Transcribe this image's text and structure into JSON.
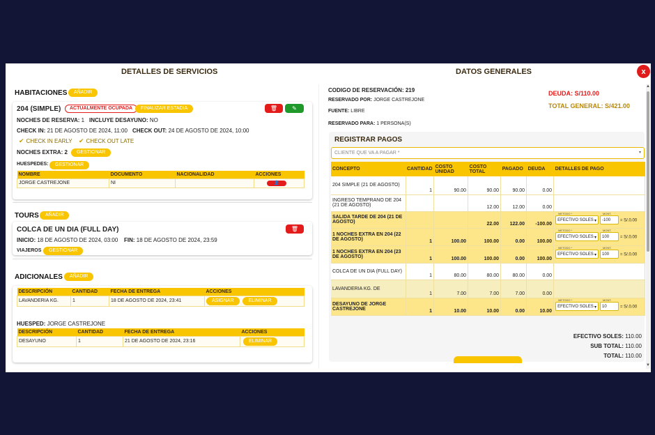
{
  "modal": {
    "left_title": "DETALLES DE SERVICIOS",
    "right_title": "DATOS GENERALES",
    "close_label": "x"
  },
  "habitaciones": {
    "title": "HABITACIONES",
    "add_label": "AÑADIR",
    "room": {
      "name": "204 (SIMPLE)",
      "status": "ACTUALMENTE OCUPADA",
      "finalize_label": "FINALIZAR ESTADIA",
      "noches_label": "NOCHES DE RESERVA:",
      "noches_value": "1",
      "desayuno_label": "INCLUYE DESAYUNO:",
      "desayuno_value": "NO",
      "checkin_label": "CHECK IN:",
      "checkin_value": "21 DE AGOSTO DE 2024, 11:00",
      "checkout_label": "CHECK OUT:",
      "checkout_value": "24 DE AGOSTO DE 2024, 10:00",
      "early_label": "CHECK IN EARLY",
      "late_label": "CHECK OUT LATE",
      "extra_label": "NOCHES EXTRA: 2",
      "extra_btn": "GESTIONAR",
      "huespedes_label": "HUESPEDES:",
      "huespedes_btn": "GESTIONAR",
      "table_headers": [
        "NOMBRE",
        "DOCUMENTO",
        "NACIONALIDAD",
        "ACCIONES"
      ],
      "guest": {
        "nombre": "JORGE CASTREJONE",
        "documento": "NI",
        "nacionalidad": ""
      }
    }
  },
  "tours": {
    "title": "TOURS",
    "add_label": "AÑADIR",
    "tour": {
      "name": "COLCA DE UN DIA (FULL DAY)",
      "inicio_label": "INICIO:",
      "inicio_value": "18 DE AGOSTO DE 2024, 03:00",
      "fin_label": "FIN:",
      "fin_value": "18 DE AGOSTO DE 2024, 23:59",
      "viajeros_label": "VIAJEROS",
      "viajeros_btn": "GESTIONAR"
    }
  },
  "adicionales": {
    "title": "ADICIONALES",
    "add_label": "AÑADIR",
    "headers": [
      "DESCRIPCIÓN",
      "CANTIDAD",
      "FECHA DE ENTREGA",
      "ACCIONES"
    ],
    "row": {
      "desc": "LAVANDERIA KG.",
      "cant": "1",
      "fecha": "18 DE AGOSTO DE 2024, 23:41",
      "asignar": "ASIGNAR",
      "eliminar": "ELIMINAR"
    },
    "huesped_label": "HUESPED:",
    "huesped_value": "JORGE CASTREJONE",
    "headers2": [
      "DESCRIPCIÓN",
      "CANTIDAD",
      "FECHA DE ENTREGA",
      "ACCIONES"
    ],
    "row2": {
      "desc": "DESAYUNO",
      "cant": "1",
      "fecha": "21 DE AGOSTO DE 2024, 23:16",
      "eliminar": "ELIMINAR"
    }
  },
  "general": {
    "codigo_label": "CODIGO DE RESERVACIÓN:",
    "codigo_value": "219",
    "reservado_por_label": "RESERVADO POR:",
    "reservado_por_value": "JORGE CASTREJONE",
    "fuente_label": "FUENTE:",
    "fuente_value": "LIBRE",
    "reservado_para_label": "RESERVADO PARA:",
    "reservado_para_value": "1 PERSONA(S)",
    "deuda_label": "DEUDA:",
    "deuda_value": "S/110.00",
    "total_label": "TOTAL GENERAL:",
    "total_value": "S/421.00"
  },
  "pagos": {
    "title": "REGISTRAR PAGOS",
    "select_placeholder": "CLIENTE QUE VA A PAGAR *",
    "headers": [
      "CONCEPTO",
      "CANTIDAD",
      "COSTO UNIDAD",
      "COSTO TOTAL",
      "PAGADO",
      "DEUDA",
      "DETALLES DE PAGO"
    ],
    "rows": [
      {
        "concepto": "204 SIMPLE (21 DE AGOSTO)",
        "cantidad": "1",
        "costo_unidad": "90.00",
        "costo_total": "90.00",
        "pagado": "90.00",
        "deuda": "0.00",
        "style": "w",
        "metodo": "",
        "monto": "",
        "calc": ""
      },
      {
        "concepto": "INGRESO TEMPRANO DE 204 (21 DE AGOSTO)",
        "cantidad": "",
        "costo_unidad": "",
        "costo_total": "12.00",
        "pagado": "12.00",
        "deuda": "0.00",
        "style": "w",
        "metodo": "",
        "monto": "",
        "calc": ""
      },
      {
        "concepto": "SALIDA TARDE DE 204 (21 DE AGOSTO)",
        "cantidad": "",
        "costo_unidad": "",
        "costo_total": "22.00",
        "pagado": "122.00",
        "deuda": "-100.00",
        "style": "y",
        "metodo": "EFECTIVO SOLES",
        "monto": "-100",
        "calc": "= S/.0.00"
      },
      {
        "concepto": "1 NOCHES EXTRA EN 204 (22 DE AGOSTO)",
        "cantidad": "1",
        "costo_unidad": "100.00",
        "costo_total": "100.00",
        "pagado": "0.00",
        "deuda": "100.00",
        "style": "y",
        "metodo": "EFECTIVO SOLES",
        "monto": "100",
        "calc": "= S/.0.00"
      },
      {
        "concepto": "1 NOCHES EXTRA EN 204 (23 DE AGOSTO)",
        "cantidad": "1",
        "costo_unidad": "100.00",
        "costo_total": "100.00",
        "pagado": "0.00",
        "deuda": "100.00",
        "style": "y",
        "metodo": "EFECTIVO SOLES",
        "monto": "100",
        "calc": "= S/.0.00"
      },
      {
        "concepto": "COLCA DE UN DIA (FULL DAY)",
        "cantidad": "1",
        "costo_unidad": "80.00",
        "costo_total": "80.00",
        "pagado": "80.00",
        "deuda": "0.00",
        "style": "w",
        "metodo": "",
        "monto": "",
        "calc": ""
      },
      {
        "concepto": "LAVANDERIA KG. DE",
        "cantidad": "1",
        "costo_unidad": "7.00",
        "costo_total": "7.00",
        "pagado": "7.00",
        "deuda": "0.00",
        "style": "ly",
        "metodo": "",
        "monto": "",
        "calc": ""
      },
      {
        "concepto": "DESAYUNO DE JORGE CASTREJONE",
        "cantidad": "1",
        "costo_unidad": "10.00",
        "costo_total": "10.00",
        "pagado": "0.00",
        "deuda": "10.00",
        "style": "y",
        "metodo": "EFECTIVO SOLES",
        "monto": "10",
        "calc": "= S/.0.00"
      }
    ],
    "metodo_label": "METODO *",
    "monto_label": "MONT.",
    "efectivo_label": "EFECTIVO SOLES:",
    "efectivo_value": "110.00",
    "subtotal_label": "SUB TOTAL:",
    "subtotal_value": "110.00",
    "total_label": "TOTAL:",
    "total_value": "110.00"
  }
}
